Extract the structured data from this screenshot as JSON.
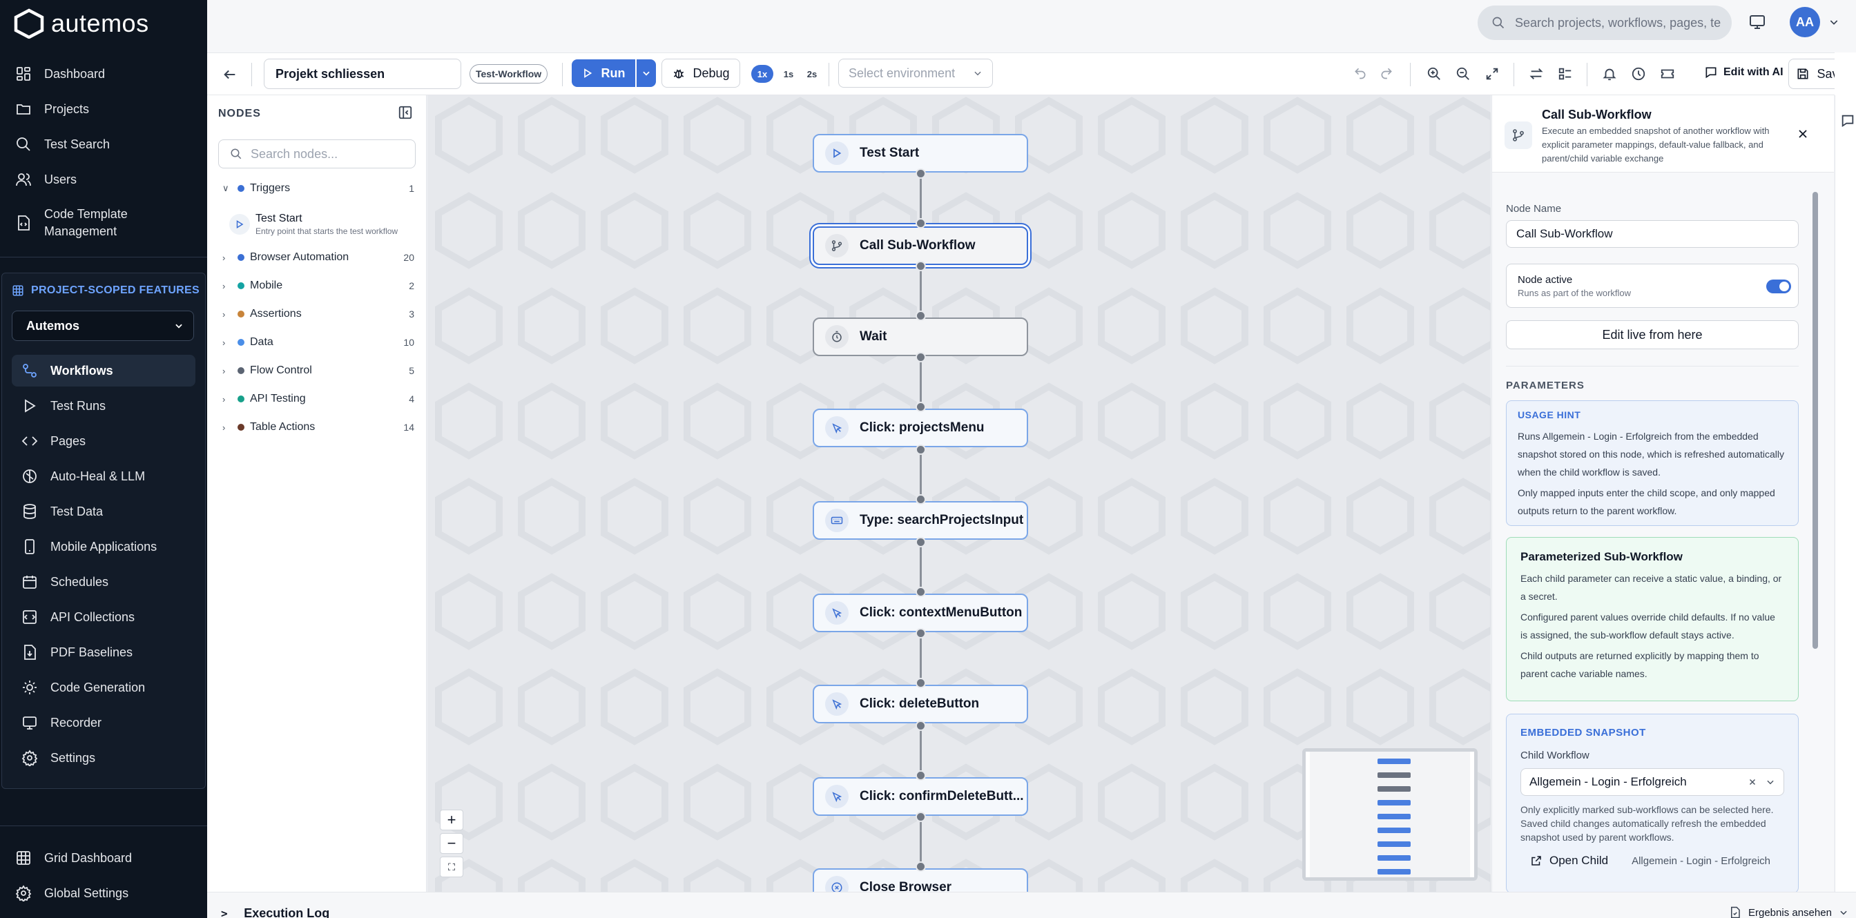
{
  "app": {
    "name": "autemos"
  },
  "sidebar": {
    "main": [
      {
        "label": "Dashboard",
        "icon": "dashboard-icon"
      },
      {
        "label": "Projects",
        "icon": "folder-icon"
      },
      {
        "label": "Test Search",
        "icon": "search-icon"
      },
      {
        "label": "Users",
        "icon": "users-icon"
      },
      {
        "label": "Code Template Management",
        "line1": "Code Template",
        "line2": "Management",
        "icon": "code-file-icon"
      }
    ],
    "scoped_title": "PROJECT-SCOPED FEATURES",
    "project": "Autemos",
    "scoped": [
      {
        "label": "Workflows",
        "icon": "workflow-icon",
        "active": true
      },
      {
        "label": "Test Runs",
        "icon": "play-icon"
      },
      {
        "label": "Pages",
        "icon": "code-icon"
      },
      {
        "label": "Auto-Heal & LLM",
        "icon": "brain-icon"
      },
      {
        "label": "Test Data",
        "icon": "database-icon"
      },
      {
        "label": "Mobile Applications",
        "icon": "mobile-icon"
      },
      {
        "label": "Schedules",
        "icon": "calendar-icon"
      },
      {
        "label": "API Collections",
        "icon": "api-icon"
      },
      {
        "label": "PDF Baselines",
        "icon": "pdf-icon"
      },
      {
        "label": "Code Generation",
        "icon": "cog-code-icon"
      },
      {
        "label": "Recorder",
        "icon": "recorder-icon"
      },
      {
        "label": "Settings",
        "icon": "gear-icon"
      }
    ],
    "bottom": [
      {
        "label": "Grid Dashboard",
        "icon": "grid-icon"
      },
      {
        "label": "Global Settings",
        "icon": "gear-icon"
      }
    ]
  },
  "topbar": {
    "search_placeholder": "Search projects, workflows, pages, te",
    "avatar": "AA"
  },
  "toolbar": {
    "workflow_name": "Projekt schliessen",
    "tag": "Test-Workflow",
    "run": "Run",
    "debug": "Debug",
    "speeds": [
      "1x",
      "1s",
      "2s"
    ],
    "environment_placeholder": "Select environment",
    "edit_ai": "Edit with AI",
    "save": "Save"
  },
  "nodes_panel": {
    "title": "NODES",
    "search_placeholder": "Search nodes...",
    "categories": [
      {
        "label": "Triggers",
        "count": "1",
        "color": "#3b6fd4",
        "expanded": true
      },
      {
        "label": "Browser Automation",
        "count": "20",
        "color": "#3b6fd4"
      },
      {
        "label": "Mobile",
        "count": "2",
        "color": "#14a3a3"
      },
      {
        "label": "Assertions",
        "count": "3",
        "color": "#c8843a"
      },
      {
        "label": "Data",
        "count": "10",
        "color": "#4a8ee8"
      },
      {
        "label": "Flow Control",
        "count": "5",
        "color": "#5b6472"
      },
      {
        "label": "API Testing",
        "count": "4",
        "color": "#17a08a"
      },
      {
        "label": "Table Actions",
        "count": "14",
        "color": "#6b3a2a"
      }
    ],
    "trigger_node": {
      "title": "Test Start",
      "desc": "Entry point that starts the test workflow"
    }
  },
  "workflow": {
    "nodes": [
      {
        "label": "Test Start",
        "icon": "play-icon",
        "style": "blue"
      },
      {
        "label": "Call Sub-Workflow",
        "icon": "subworkflow-icon",
        "style": "selected"
      },
      {
        "label": "Wait",
        "icon": "timer-icon",
        "style": "gray"
      },
      {
        "label": "Click: projectsMenu",
        "icon": "cursor-click-icon",
        "style": "blue"
      },
      {
        "label": "Type: searchProjectsInput",
        "icon": "keyboard-icon",
        "style": "blue"
      },
      {
        "label": "Click: contextMenuButton",
        "icon": "cursor-click-icon",
        "style": "blue"
      },
      {
        "label": "Click: deleteButton",
        "icon": "cursor-click-icon",
        "style": "blue"
      },
      {
        "label": "Click: confirmDeleteButt...",
        "icon": "cursor-click-icon",
        "style": "blue"
      },
      {
        "label": "Close Browser",
        "icon": "close-circle-icon",
        "style": "blue"
      }
    ]
  },
  "properties": {
    "title": "Call Sub-Workflow",
    "description": "Execute an embedded snapshot of another workflow with explicit parameter mappings, default-value fallback, and parent/child variable exchange",
    "node_name_label": "Node Name",
    "node_name": "Call Sub-Workflow",
    "node_active_label": "Node active",
    "node_active_desc": "Runs as part of the workflow",
    "edit_live": "Edit live from here",
    "parameters_title": "PARAMETERS",
    "usage_hint_title": "USAGE HINT",
    "usage_hint_p1": "Runs Allgemein - Login - Erfolgreich from the embedded snapshot stored on this node, which is refreshed automatically when the child workflow is saved.",
    "usage_hint_p2": "Only mapped inputs enter the child scope, and only mapped outputs return to the parent workflow.",
    "param_title": "Parameterized Sub-Workflow",
    "param_p1": "Each child parameter can receive a static value, a binding, or a secret.",
    "param_p2": "Configured parent values override child defaults. If no value is assigned, the sub-workflow default stays active.",
    "param_p3": "Child outputs are returned explicitly by mapping them to parent cache variable names.",
    "snapshot_title": "EMBEDDED SNAPSHOT",
    "child_label": "Child Workflow",
    "child_value": "Allgemein - Login - Erfolgreich",
    "child_note": "Only explicitly marked sub-workflows can be selected here. Saved child changes automatically refresh the embedded snapshot used by parent workflows.",
    "open_child": "Open Child",
    "open_child_name": "Allgemein - Login - Erfolgreich"
  },
  "logbar": {
    "title": "Execution Log",
    "right": "Ergebnis ansehen"
  }
}
